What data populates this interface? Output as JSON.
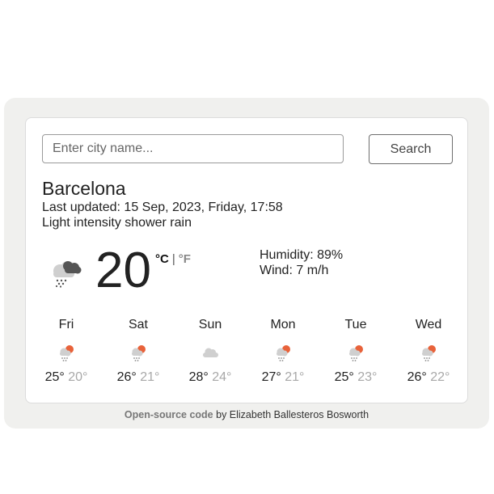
{
  "search": {
    "placeholder": "Enter city name...",
    "value": "",
    "button_label": "Search"
  },
  "current": {
    "city": "Barcelona",
    "last_updated": "Last updated: 15 Sep, 2023, Friday, 17:58",
    "description": "Light intensity shower rain",
    "icon": "storm-cloud-rain-icon",
    "temperature": "20",
    "unit_celsius": "°C",
    "unit_separator": "|",
    "unit_fahrenheit": "°F",
    "humidity": "Humidity: 89%",
    "wind": "Wind: 7 m/h"
  },
  "forecast": [
    {
      "day": "Fri",
      "icon": "sun-cloud-rain-icon",
      "max": "25°",
      "min": "20°"
    },
    {
      "day": "Sat",
      "icon": "sun-cloud-rain-icon",
      "max": "26°",
      "min": "21°"
    },
    {
      "day": "Sun",
      "icon": "cloud-icon",
      "max": "28°",
      "min": "24°"
    },
    {
      "day": "Mon",
      "icon": "sun-cloud-rain-icon",
      "max": "27°",
      "min": "21°"
    },
    {
      "day": "Tue",
      "icon": "sun-cloud-rain-icon",
      "max": "25°",
      "min": "23°"
    },
    {
      "day": "Wed",
      "icon": "sun-cloud-rain-icon",
      "max": "26°",
      "min": "22°"
    }
  ],
  "footer": {
    "link_text": "Open-source code",
    "rest": " by Elizabeth Ballesteros Bosworth"
  },
  "colors": {
    "sun": "#e8623a",
    "cloud": "#cfcfcf",
    "storm_cloud": "#555555",
    "rain": "#8a8a8a",
    "min_temp": "#a8a8a8"
  }
}
